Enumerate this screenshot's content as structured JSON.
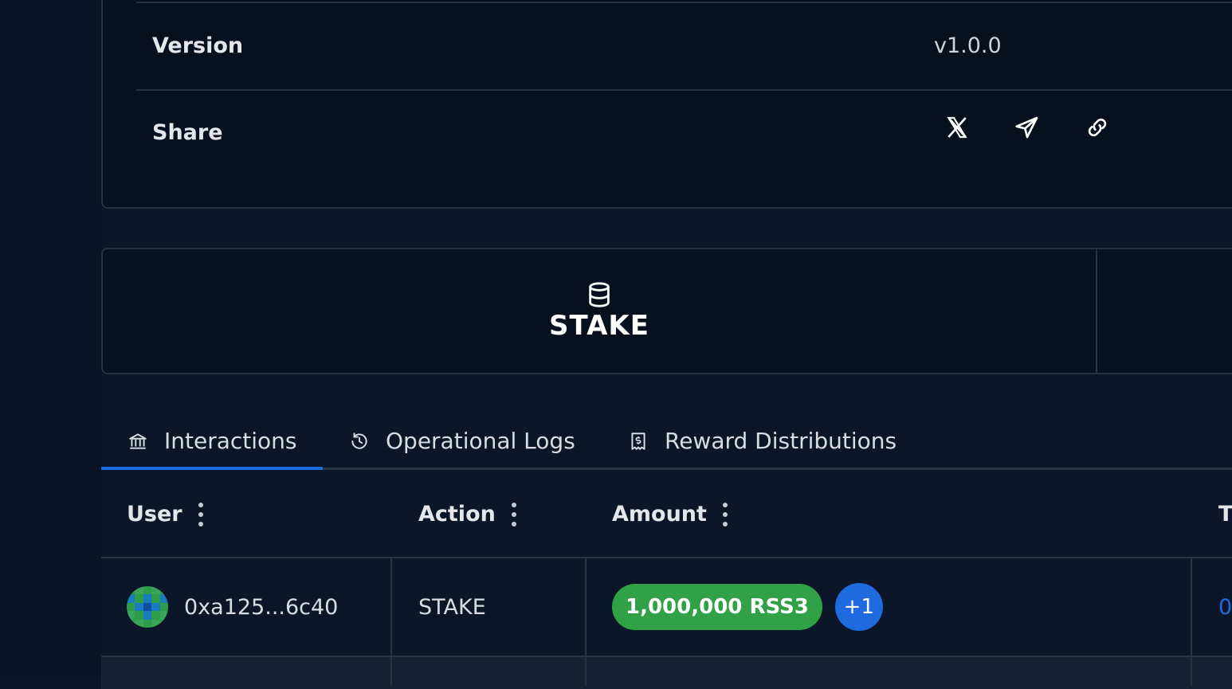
{
  "info": {
    "version_label": "Version",
    "version_value": "v1.0.0",
    "share_label": "Share",
    "share_icons": [
      "x-icon",
      "telegram-icon",
      "link-icon"
    ]
  },
  "stake": {
    "label": "STAKE",
    "icon": "database-icon"
  },
  "tabs": [
    {
      "label": "Interactions",
      "icon": "bank-icon",
      "active": true
    },
    {
      "label": "Operational Logs",
      "icon": "history-icon",
      "active": false
    },
    {
      "label": "Reward Distributions",
      "icon": "receipt-icon",
      "active": false
    }
  ],
  "table": {
    "headers": {
      "user": "User",
      "action": "Action",
      "amount": "Amount",
      "next_cut": "T"
    },
    "rows": [
      {
        "user": "0xa125...6c40",
        "action": "STAKE",
        "amount": "1,000,000 RSS3",
        "more": "+1",
        "next_cut": "0"
      }
    ]
  },
  "colors": {
    "background": "#0b1629",
    "card": "#06101f",
    "accent_blue": "#1e6be0",
    "amount_green": "#31a147",
    "border": "#27313f"
  }
}
